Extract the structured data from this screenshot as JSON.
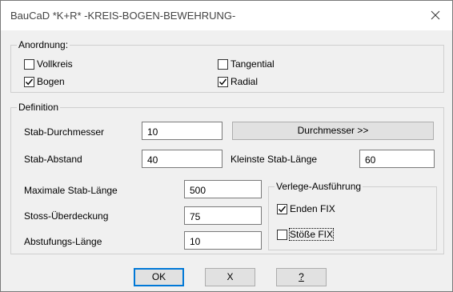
{
  "window": {
    "title": "BauCaD *K+R* -KREIS-BOGEN-BEWEHRUNG-",
    "close_icon": "close-icon"
  },
  "anordnung": {
    "legend": "Anordnung:",
    "vollkreis": {
      "label": "Vollkreis",
      "checked": false
    },
    "bogen": {
      "label": "Bogen",
      "checked": true
    },
    "tangential": {
      "label": "Tangential",
      "checked": false
    },
    "radial": {
      "label": "Radial",
      "checked": true
    }
  },
  "definition": {
    "legend": "Definition",
    "stab_durchmesser": {
      "label": "Stab-Durchmesser",
      "value": "10"
    },
    "durchmesser_button": "Durchmesser >>",
    "stab_abstand": {
      "label": "Stab-Abstand",
      "value": "40"
    },
    "kleinste_stab_laenge": {
      "label": "Kleinste Stab-Länge",
      "value": "60"
    },
    "maximale_stab_laenge": {
      "label": "Maximale Stab-Länge",
      "value": "500"
    },
    "stoss_ueberdeckung": {
      "label": "Stoss-Überdeckung",
      "value": "75"
    },
    "abstufungs_laenge": {
      "label": "Abstufungs-Länge",
      "value": "10"
    }
  },
  "verlege": {
    "legend": "Verlege-Ausführung",
    "enden_fix": {
      "label": "Enden FIX",
      "checked": true
    },
    "stoesse_fix": {
      "label": "Stöße FIX",
      "checked": false
    }
  },
  "buttons": {
    "ok": "OK",
    "cancel": "X",
    "help": "?"
  }
}
